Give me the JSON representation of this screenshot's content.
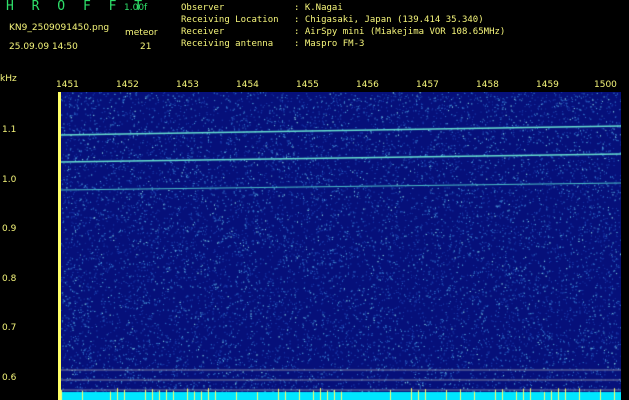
{
  "header": {
    "brand": "H R O F F T",
    "version": "1.00f",
    "filename": "KN9_2509091450.png",
    "meteor_label": "meteor",
    "datetime": "25.09.09 14:50",
    "meteor_count": "21"
  },
  "meta": [
    {
      "key": "Observer",
      "value": ": K.Nagai"
    },
    {
      "key": "Receiving Location",
      "value": ": Chigasaki, Japan (139.414 35.340)"
    },
    {
      "key": "Receiver",
      "value": ": AirSpy mini (Miakejima VOR 108.65MHz)"
    },
    {
      "key": "Receiving antenna",
      "value": ": Maspro FM-3"
    }
  ],
  "axis": {
    "y_unit": "kHz",
    "y_ticks": [
      "1.1",
      "1.0",
      "0.9",
      "0.8",
      "0.7",
      "0.6"
    ],
    "x_ticks": [
      "1451",
      "1452",
      "1453",
      "1454",
      "1455",
      "1456",
      "1457",
      "1458",
      "1459",
      "1500"
    ]
  },
  "colors": {
    "label": "#f5f57a",
    "brand": "#2ee06a",
    "background": "#000000",
    "spectrogram_bg": "#06107a",
    "trace": "#66e0d0"
  }
}
